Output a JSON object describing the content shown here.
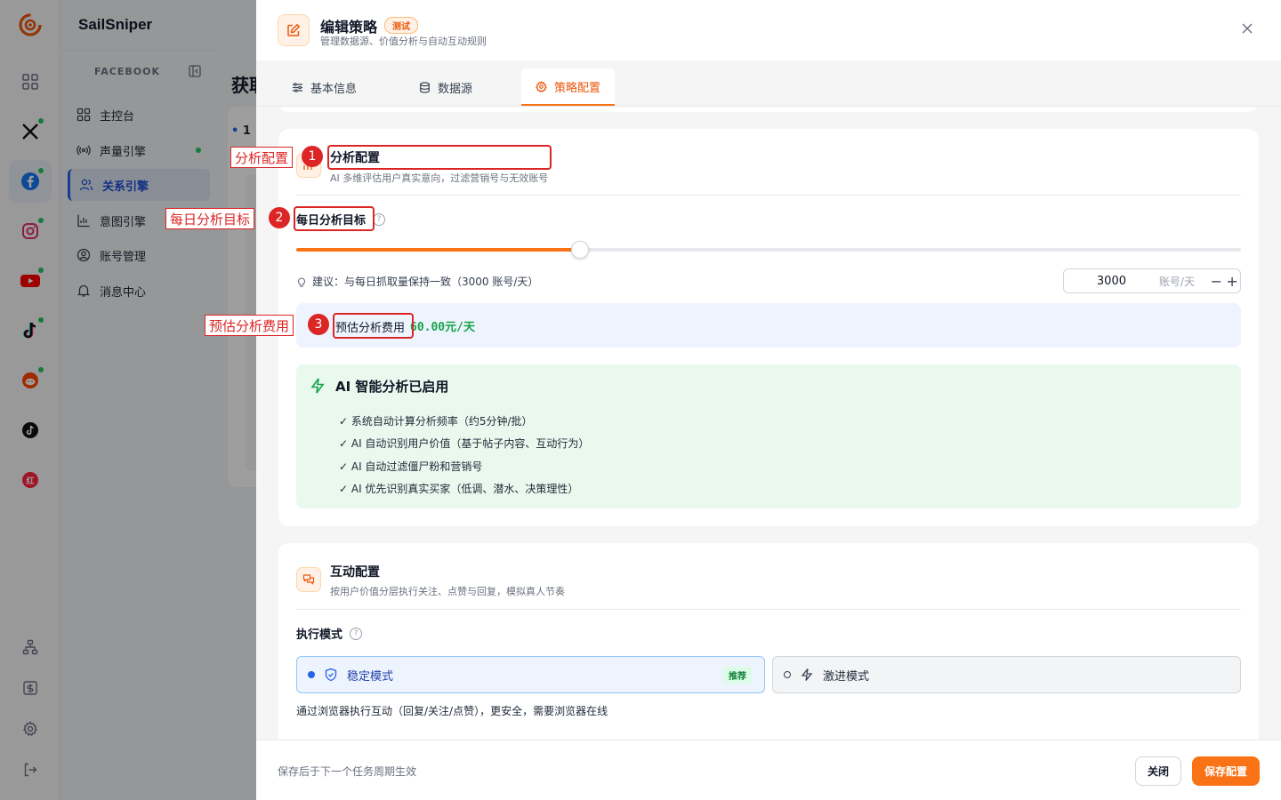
{
  "app": {
    "brand": "SailSniper"
  },
  "rail": {
    "items": [
      {
        "name": "grid",
        "dot": false
      },
      {
        "name": "x",
        "dot": true
      },
      {
        "name": "facebook",
        "dot": true,
        "active": true
      },
      {
        "name": "instagram",
        "dot": true
      },
      {
        "name": "youtube",
        "dot": true
      },
      {
        "name": "tiktok",
        "dot": true
      },
      {
        "name": "reddit",
        "dot": true
      },
      {
        "name": "tiktok-alt",
        "dot": false
      },
      {
        "name": "xiaohongshu",
        "dot": false
      }
    ]
  },
  "nav": {
    "section": "FACEBOOK",
    "items": [
      {
        "label": "主控台",
        "icon": "dashboard-icon"
      },
      {
        "label": "声量引擎",
        "icon": "broadcast-icon",
        "dot": true
      },
      {
        "label": "关系引擎",
        "icon": "users-icon",
        "active": true
      },
      {
        "label": "意图引擎",
        "icon": "chart-icon"
      },
      {
        "label": "账号管理",
        "icon": "account-icon"
      },
      {
        "label": "消息中心",
        "icon": "bell-icon"
      }
    ]
  },
  "background": {
    "page_title": "获取",
    "step": "1"
  },
  "drawer": {
    "title": "编辑策略",
    "badge": "测试",
    "subtitle": "管理数据源、价值分析与自动互动规则",
    "tabs": [
      {
        "label": "基本信息",
        "icon": "sliders-icon"
      },
      {
        "label": "数据源",
        "icon": "database-icon"
      },
      {
        "label": "策略配置",
        "icon": "gear-icon",
        "active": true
      }
    ],
    "analysis": {
      "title": "分析配置",
      "subtitle": "AI 多维评估用户真实意向，过滤营销号与无效账号",
      "daily_label": "每日分析目标",
      "slider_fraction": 0.3,
      "tip": "建议：与每日抓取量保持一致（3000 账号/天）",
      "value": "3000",
      "unit": "账号/天",
      "cost_label": "预估分析费用",
      "cost_value": "60.00元/天",
      "ai_title": "AI 智能分析已启用",
      "ai_items": [
        "✓ 系统自动计算分析频率（约5分钟/批）",
        "✓ AI 自动识别用户价值（基于帖子内容、互动行为）",
        "✓ AI 自动过滤僵尸粉和营销号",
        "✓ AI 优先识别真实买家（低调、潜水、决策理性）"
      ]
    },
    "interaction": {
      "title": "互动配置",
      "subtitle": "按用户价值分层执行关注、点赞与回复，模拟真人节奏",
      "mode_label": "执行模式",
      "modes": [
        {
          "label": "稳定模式",
          "badge": "推荐",
          "selected": true
        },
        {
          "label": "激进模式",
          "selected": false
        }
      ],
      "mode_desc": "通过浏览器执行互动（回复/关注/点赞），更安全，需要浏览器在线"
    },
    "footer": {
      "note": "保存后于下一个任务周期生效",
      "close": "关闭",
      "save": "保存配置"
    }
  },
  "annotations": [
    {
      "num": "1",
      "label": "分析配置"
    },
    {
      "num": "2",
      "label": "每日分析目标"
    },
    {
      "num": "3",
      "label": "预估分析费用"
    }
  ],
  "colors": {
    "accent": "#f97316",
    "primary": "#2563eb",
    "success": "#16a34a",
    "annotation": "#dc2626"
  }
}
